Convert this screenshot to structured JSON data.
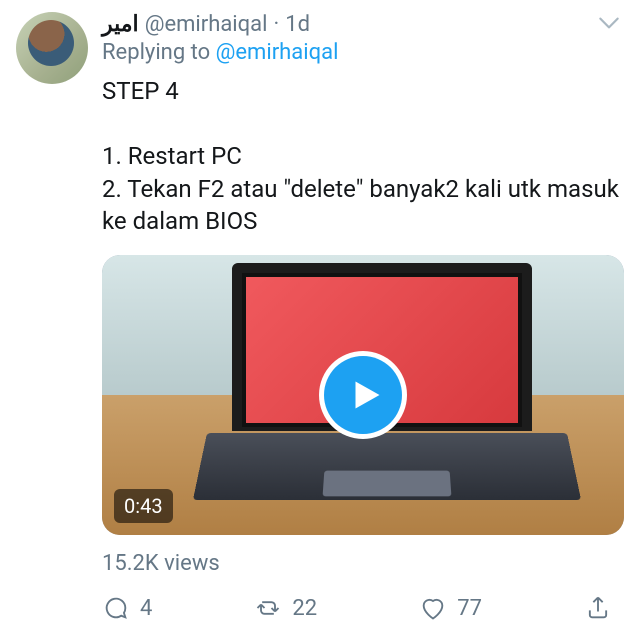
{
  "header": {
    "display_name": "امير",
    "handle": "@emirhaiqal",
    "separator": "·",
    "time": "1d",
    "replying_prefix": "Replying to ",
    "replying_to": "@emirhaiqal"
  },
  "body": {
    "text": "STEP 4\n\n1. Restart PC\n2. Tekan F2 atau \"delete\" banyak2 kali utk masuk ke dalam BIOS"
  },
  "media": {
    "duration": "0:43",
    "views_text": "15.2K views"
  },
  "actions": {
    "reply_count": "4",
    "retweet_count": "22",
    "like_count": "77"
  }
}
